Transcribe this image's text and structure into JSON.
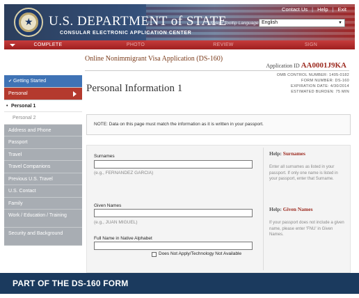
{
  "header": {
    "top_links": [
      "Contact Us",
      "Help",
      "Exit"
    ],
    "dept_title": "U.S. DEPARTMENT of STATE",
    "dept_subtitle": "CONSULAR ELECTRONIC APPLICATION CENTER",
    "language_label": "Select Tooltip Language",
    "language_value": "English",
    "seal_icon": "state-department-seal-icon"
  },
  "progress": {
    "steps": [
      "COMPLETE",
      "PHOTO",
      "REVIEW",
      "SIGN"
    ],
    "active_index": 0
  },
  "application": {
    "title": "Online Nonimmigrant Visa Application (DS-160)",
    "id_label": "Application ID",
    "id_value": "AA0001J9KA"
  },
  "sidebar": {
    "items": [
      "Getting Started",
      "Personal",
      "Personal 1",
      "Personal 2",
      "Address and Phone",
      "Passport",
      "Travel",
      "Travel Companions",
      "Previous U.S. Travel",
      "U.S. Contact",
      "Family",
      "Work / Education / Training",
      "Security and Background"
    ]
  },
  "main": {
    "heading": "Personal Information 1",
    "omb": [
      "OMB CONTROL NUMBER: 1405-0182",
      "FORM NUMBER: DS-160",
      "EXPIRATION DATE: 4/30/2014",
      "ESTIMATED BURDEN: 75 MIN"
    ],
    "note": "NOTE: Data on this page must match the information as it is written in your passport."
  },
  "form": {
    "surnames_label": "Surnames",
    "surnames_example": "(e.g., FERNANDEZ GARCIA)",
    "given_label": "Given Names",
    "given_example": "(e.g., JUAN MIGUEL)",
    "native_label": "Full Name in Native Alphabet",
    "not_apply_label": "Does Not Apply/Technology Not Available"
  },
  "help": {
    "prefix": "Help:",
    "surnames_title": "Surnames",
    "surnames_text": "Enter all surnames as listed in your passport. If only one name is listed in your passport, enter that Surname.",
    "given_title": "Given Names",
    "given_text": "If your passport does not include a given name, please enter 'FNU' in Given Names."
  },
  "banner": {
    "text": "PART OF THE DS-160 FORM"
  }
}
